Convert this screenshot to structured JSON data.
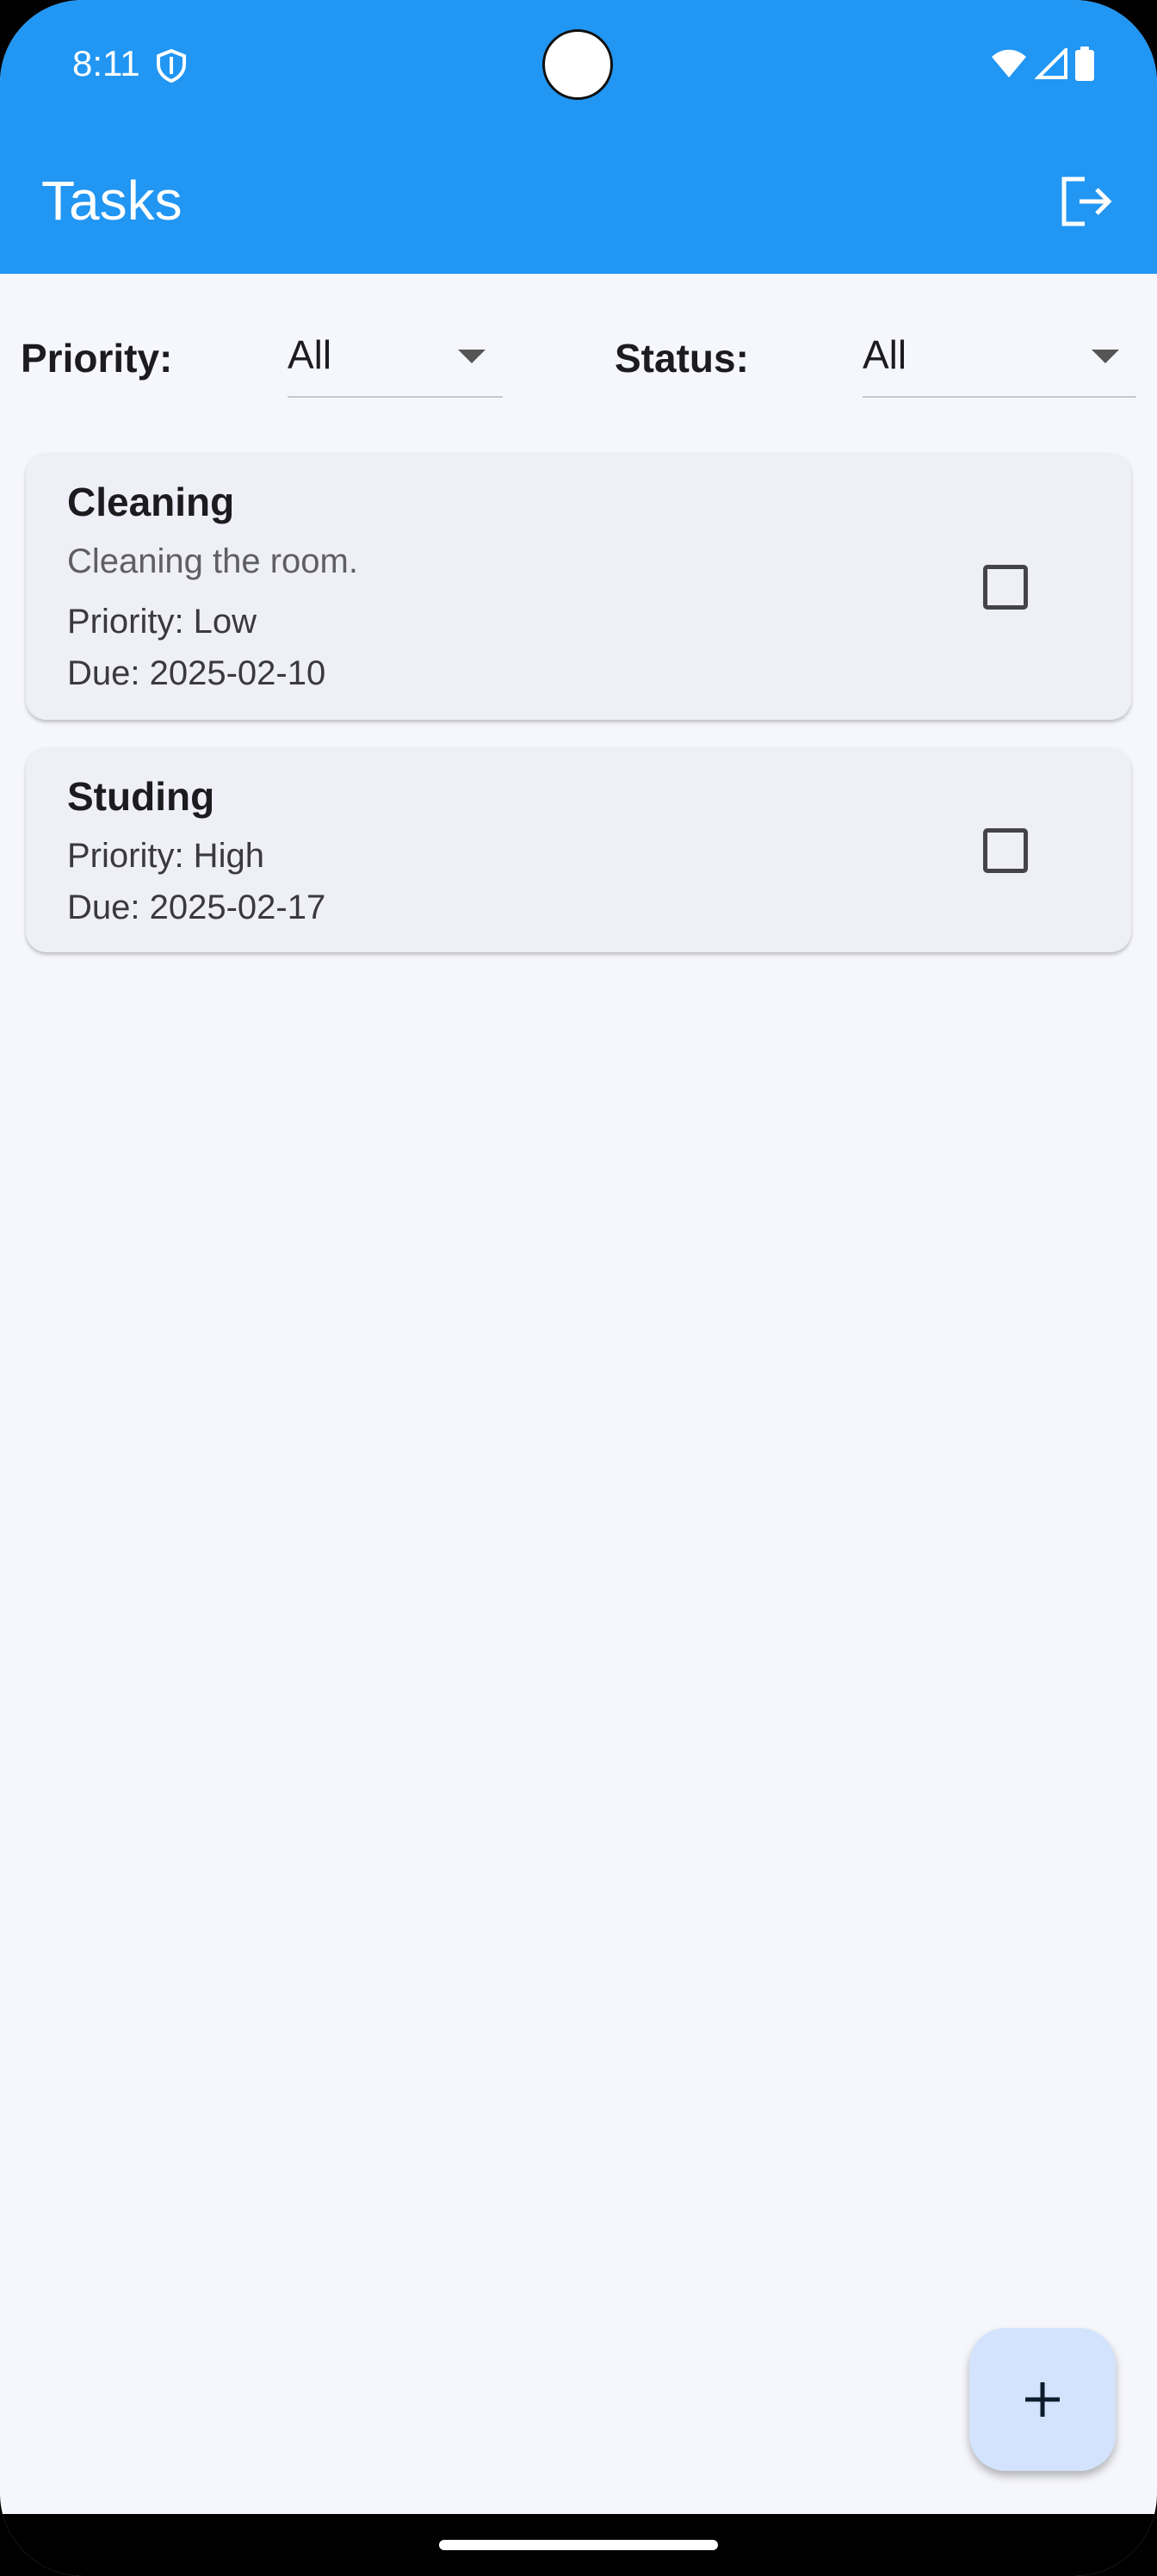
{
  "status_bar": {
    "time": "8:11"
  },
  "app_bar": {
    "title": "Tasks",
    "logout_icon": "logout-icon"
  },
  "filters": {
    "priority_label": "Priority:",
    "priority_value": "All",
    "status_label": "Status:",
    "status_value": "All"
  },
  "tasks": [
    {
      "title": "Cleaning",
      "description": "Cleaning the room.",
      "priority": "Priority: Low",
      "due": "Due: 2025-02-10",
      "checked": false
    },
    {
      "title": "Studing",
      "priority": "Priority: High",
      "due": "Due: 2025-02-17",
      "checked": false
    }
  ],
  "fab": {
    "icon": "plus-icon"
  },
  "colors": {
    "app_bar": "#2196f3",
    "background": "#f6f7fc",
    "card": "#eff0f7",
    "fab": "#d3e3fd"
  }
}
